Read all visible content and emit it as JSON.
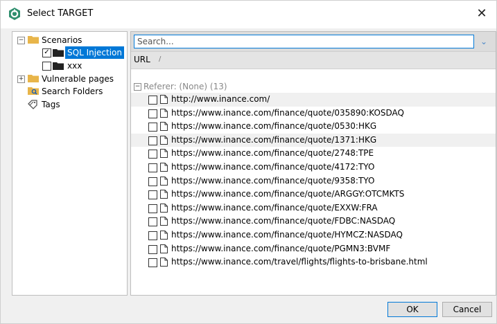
{
  "window": {
    "title": "Select TARGET",
    "close_glyph": "✕"
  },
  "tree": {
    "scenarios": "Scenarios",
    "items": [
      {
        "label": "SQL Injection",
        "checked": "✓"
      },
      {
        "label": "xxx",
        "checked": ""
      }
    ],
    "vulnerable_pages": "Vulnerable pages",
    "search_folders": "Search Folders",
    "tags": "Tags",
    "expanded": "−",
    "collapsed": "+"
  },
  "search": {
    "placeholder": "Search...",
    "button_glyph": "⌄"
  },
  "table": {
    "column": "URL",
    "sort_glyph": "/"
  },
  "group": {
    "label": "Referer: (None) (13)",
    "expand_glyph": "−"
  },
  "urls": [
    "http://www.inance.com/",
    "https://www.inance.com/finance/quote/035890:KOSDAQ",
    "https://www.inance.com/finance/quote/0530:HKG",
    "https://www.inance.com/finance/quote/1371:HKG",
    "https://www.inance.com/finance/quote/2748:TPE",
    "https://www.inance.com/finance/quote/4172:TYO",
    "https://www.inance.com/finance/quote/9358:TYO",
    "https://www.inance.com/finance/quote/ARGGY:OTCMKTS",
    "https://www.inance.com/finance/quote/EXXW:FRA",
    "https://www.inance.com/finance/quote/FDBC:NASDAQ",
    "https://www.inance.com/finance/quote/HYMCZ:NASDAQ",
    "https://www.inance.com/finance/quote/PGMN3:BVMF",
    "https://www.inance.com/travel/flights/flights-to-brisbane.html"
  ],
  "buttons": {
    "ok": "OK",
    "cancel": "Cancel"
  },
  "colors": {
    "accent": "#0078d7",
    "folder": "#e8b54a",
    "brand": "#2f8f6e"
  },
  "icons": {
    "app": "app-logo-icon",
    "folder": "folder-icon",
    "document": "document-icon",
    "tag": "tag-icon",
    "search_folder": "search-folder-icon"
  }
}
